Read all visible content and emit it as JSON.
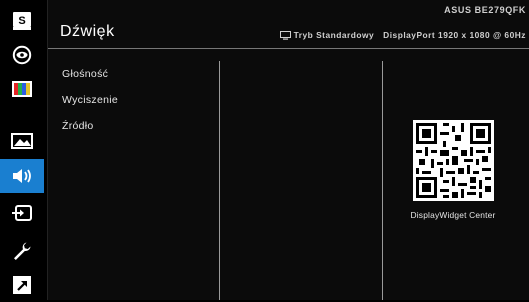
{
  "window": {
    "title": "Dźwięk"
  },
  "header": {
    "model": "ASUS BE279QFK",
    "mode": "Tryb Standardowy",
    "input": "DisplayPort 1920 x 1080 @ 60Hz"
  },
  "sidebar": {
    "items": [
      {
        "icon": "s-badge-icon",
        "active": false
      },
      {
        "icon": "eye-icon",
        "active": false
      },
      {
        "icon": "color-bars-icon",
        "active": false
      },
      {
        "icon": "image-icon",
        "active": false
      },
      {
        "icon": "speaker-icon",
        "active": true
      },
      {
        "icon": "input-source-icon",
        "active": false
      },
      {
        "icon": "wrench-icon",
        "active": false
      },
      {
        "icon": "shortcut-icon",
        "active": false
      }
    ]
  },
  "menu": {
    "items": [
      {
        "label": "Głośność"
      },
      {
        "label": "Wyciszenie"
      },
      {
        "label": "Źródło"
      }
    ]
  },
  "qr": {
    "label": "DisplayWidget Center"
  },
  "colors": {
    "accent": "#1a7fd0",
    "background": "#0b0b0b",
    "divider": "#9a9a9a"
  }
}
